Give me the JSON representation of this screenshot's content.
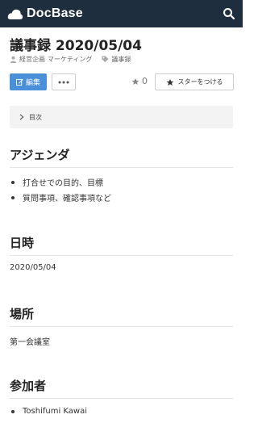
{
  "header": {
    "brand": "DocBase"
  },
  "doc": {
    "title": "議事録 2020/05/04",
    "groups": [
      "経営企画",
      "マーケティング"
    ],
    "tag": "議事録"
  },
  "actions": {
    "edit_label": "編集",
    "star_count": "0",
    "star_label": "スターをつける"
  },
  "toc": {
    "label": "目次"
  },
  "sections": {
    "agenda": {
      "heading": "アジェンダ",
      "items": [
        "打合せでの目的、目標",
        "質問事項、確認事項など"
      ]
    },
    "datetime": {
      "heading": "日時",
      "text": "2020/05/04"
    },
    "place": {
      "heading": "場所",
      "text": "第一会議室"
    },
    "attendees": {
      "heading": "参加者",
      "items": [
        "Toshifumi Kawai"
      ]
    }
  },
  "colors": {
    "header_bg": "#1e2e3e",
    "edit_button": "#4a90d9"
  },
  "icons": {
    "search": "search-icon",
    "group": "user-group-icon",
    "tag": "tag-icon",
    "star": "star-icon",
    "more": "ellipsis-icon",
    "toc": "chevron-right-icon"
  }
}
